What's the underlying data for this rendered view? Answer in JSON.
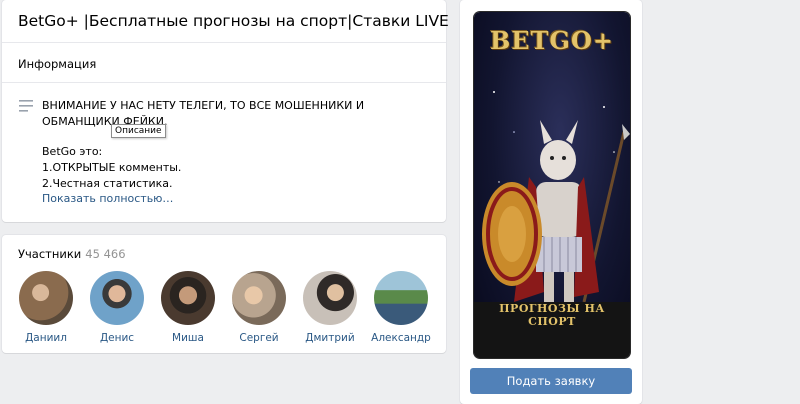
{
  "group": {
    "title": "BetGo+ |Бесплатные прогнозы на спорт|Ставки LIVE"
  },
  "info": {
    "section_label": "Информация",
    "description_text": "ВНИМАНИЕ У НАС НЕТУ ТЕЛЕГИ, ТО ВСЕ МОШЕННИКИ И ОБМАНЩИКИ ФЕЙКИ.",
    "tooltip": "Описание",
    "lines": [
      "BetGo это:",
      "1.ОТКРЫТЫЕ комменты.",
      "2.Честная статистика."
    ],
    "show_more": "Показать полностью…"
  },
  "members": {
    "label": "Участники",
    "count": "45 466",
    "people": [
      {
        "name": "Даниил",
        "avatar_color": "#8a6b4e"
      },
      {
        "name": "Денис",
        "avatar_color": "#6fa2c9"
      },
      {
        "name": "Миша",
        "avatar_color": "#4a3a2f"
      },
      {
        "name": "Сергей",
        "avatar_color": "#b8a48f"
      },
      {
        "name": "Дмитрий",
        "avatar_color": "#7a6a60"
      },
      {
        "name": "Александр",
        "avatar_color": "#4f7a8a"
      }
    ]
  },
  "sidebar": {
    "poster_title": "BETGO+",
    "poster_caption": "ПРОГНОЗЫ НА СПОРТ",
    "button_label": "Подать заявку"
  },
  "colors": {
    "accent": "#5181b8",
    "link": "#2a5885",
    "background": "#edeef0"
  }
}
